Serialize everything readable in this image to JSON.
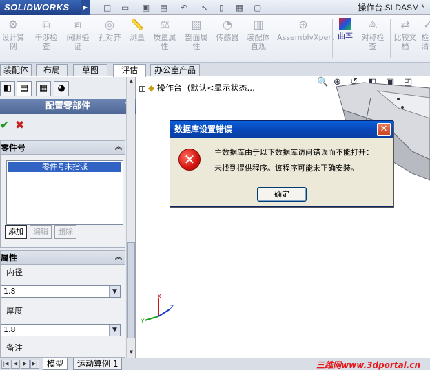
{
  "app": {
    "logo_text": "SOLIDWORKS",
    "document_title": "操作台.SLDASM *"
  },
  "ribbon": {
    "tools": [
      {
        "label": "设计算\n例",
        "active": false
      },
      {
        "label": "干涉检\n查",
        "active": false
      },
      {
        "label": "间隙验\n证",
        "active": false
      },
      {
        "label": "孔对齐",
        "active": false
      },
      {
        "label": "测量",
        "active": false
      },
      {
        "label": "质量属\n性",
        "active": false
      },
      {
        "label": "剖面属\n性",
        "active": false
      },
      {
        "label": "传感器",
        "active": false
      },
      {
        "label": "装配体\n直观",
        "active": false
      },
      {
        "label": "AssemblyXpert",
        "active": false
      },
      {
        "label": "曲率",
        "active": true
      },
      {
        "label": "对称检\n查",
        "active": false
      },
      {
        "label": "比较文\n档",
        "active": false
      },
      {
        "label": "检\n清",
        "active": false
      }
    ]
  },
  "tabs": [
    "装配体",
    "布局",
    "草图",
    "评估",
    "办公室产品"
  ],
  "active_tab": "评估",
  "property_manager": {
    "title": "配置零部件",
    "help": "?",
    "ok_icon": "✔",
    "cancel_icon": "✖",
    "part_number_group": {
      "title": "零件号",
      "selected_item": "零件号未指派",
      "buttons": {
        "add": "添加",
        "edit": "编辑",
        "delete": "删除"
      }
    },
    "properties_group": {
      "title": "属性",
      "inner_diameter_label": "内径",
      "inner_diameter_value": "1.8",
      "thickness_label": "厚度",
      "thickness_value": "1.8",
      "note_label": "备注"
    }
  },
  "tree": {
    "node_label": "操作台",
    "node_state": "(默认<显示状态..."
  },
  "dialog": {
    "title": "数据库设置错误",
    "close_label": "✕",
    "line1": "主数据库由于以下数据库访问错误而不能打开：",
    "line2": "未找到提供程序。该程序可能未正确安装。",
    "ok_label": "确定"
  },
  "bottom_tabs": [
    "模型",
    "运动算例 1"
  ],
  "watermark": "三维网www.3dportal.cn",
  "colors": {
    "accent": "#3163c5",
    "dialog_title": "#0847ba",
    "error_red": "#d2150e",
    "watermark_red": "#e31b1b"
  }
}
